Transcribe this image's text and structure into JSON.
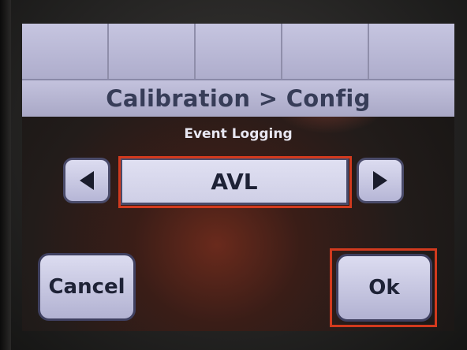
{
  "title": "Calibration > Config",
  "field": {
    "label": "Event Logging",
    "value": "AVL"
  },
  "buttons": {
    "prev_icon": "triangle-left-icon",
    "next_icon": "triangle-right-icon",
    "cancel_label": "Cancel",
    "ok_label": "Ok"
  },
  "colors": {
    "button_face": "#c8c8e4",
    "title_text": "#373d58",
    "highlight": "#d23a1e"
  }
}
